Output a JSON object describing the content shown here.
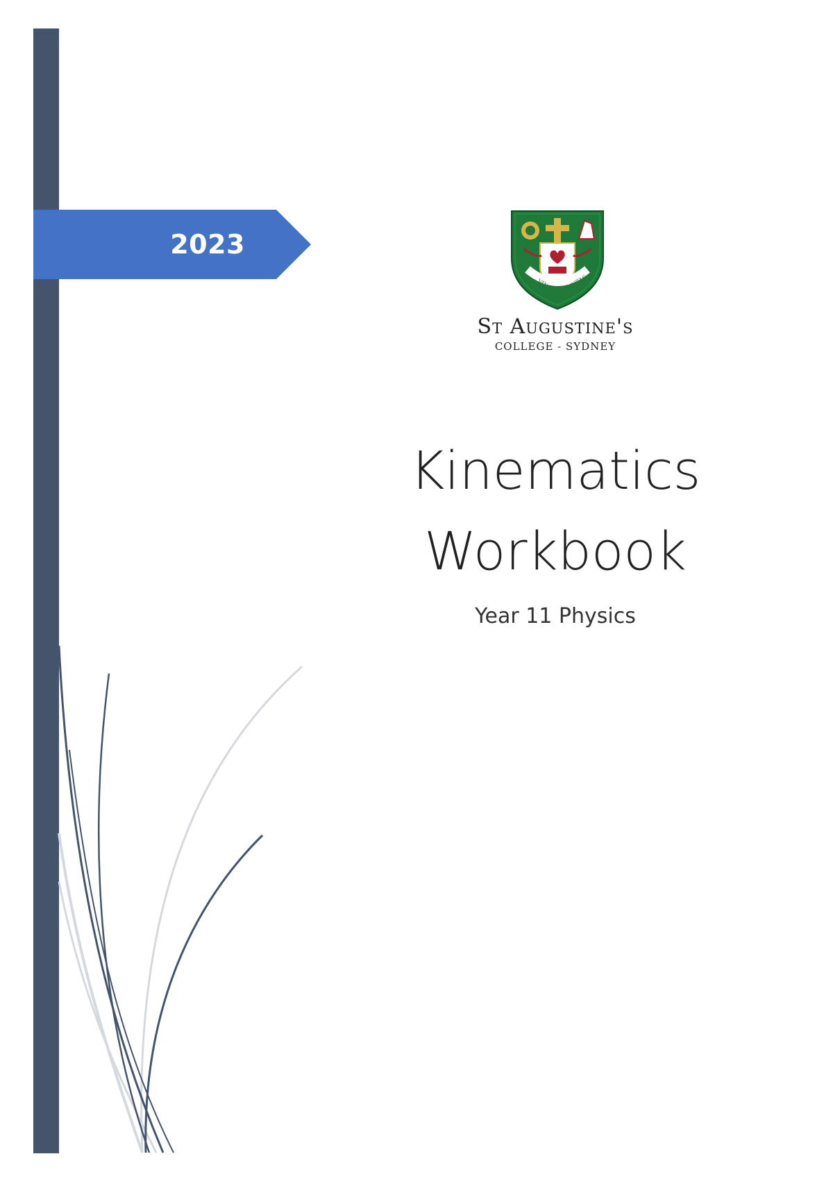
{
  "cover": {
    "year": "2023",
    "school": {
      "name_line1": "St Augustine's",
      "name_line2": "COLLEGE - SYDNEY",
      "motto_left": "VINCIT",
      "motto_right": "VERITAS"
    },
    "title_line1": "Kinematics",
    "title_line2": "Workbook",
    "subtitle": "Year 11 Physics"
  },
  "colors": {
    "sidebar": "#44546a",
    "year_tab": "#4472c4",
    "crest_green": "#1f7a3a",
    "crest_red": "#b01e2f",
    "crest_gold": "#d8b54a",
    "curve_dark": "#44546a",
    "curve_light": "#d5d9de"
  }
}
